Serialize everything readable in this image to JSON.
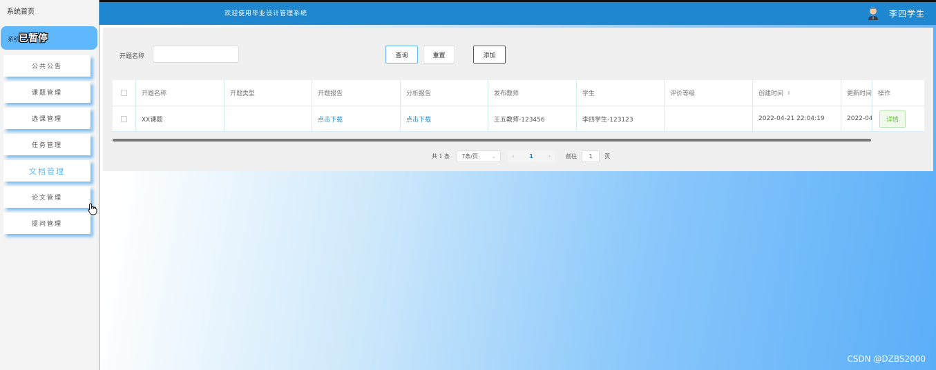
{
  "sidebar": {
    "home_label": "系统首页",
    "active_small": "系统",
    "active_badge": "已暂停",
    "items": [
      {
        "label": "公共公告"
      },
      {
        "label": "课题管理"
      },
      {
        "label": "选课管理"
      },
      {
        "label": "任务管理"
      },
      {
        "label": "文档管理"
      },
      {
        "label": "论文管理"
      },
      {
        "label": "提问管理"
      }
    ]
  },
  "header": {
    "title": "欢迎使用毕业设计管理系统",
    "user_name": "李四学生",
    "avatar_icon": "user-avatar-icon"
  },
  "search": {
    "label": "开题名称",
    "value": "",
    "placeholder": "",
    "query_label": "查询",
    "reset_label": "重置",
    "add_label": "添加"
  },
  "table": {
    "headers": [
      "开题名称",
      "开题类型",
      "开题报告",
      "分析报告",
      "发布教师",
      "学生",
      "评价等级",
      "创建时间",
      "更新时间",
      "操作"
    ],
    "rows": [
      {
        "name": "XX课题",
        "type": "",
        "report": "点击下载",
        "analysis": "点击下载",
        "teacher": "王五教师-123456",
        "student": "李四学生-123123",
        "grade": "",
        "created": "2022-04-21 22:04:19",
        "updated": "2022-04",
        "action": "详情"
      }
    ],
    "sort_icon": "sort-icon"
  },
  "pagination": {
    "total": "共 1 条",
    "page_size": "7条/页",
    "current_page": "1",
    "goto_prefix": "前往",
    "goto_value": "1",
    "goto_suffix": "页"
  },
  "watermark": "CSDN @DZBS2000",
  "colors": {
    "header_bg": "#1e87d0",
    "active_menu": "#5eb8fb",
    "link": "#1e87d0",
    "success": "#67c23a"
  }
}
